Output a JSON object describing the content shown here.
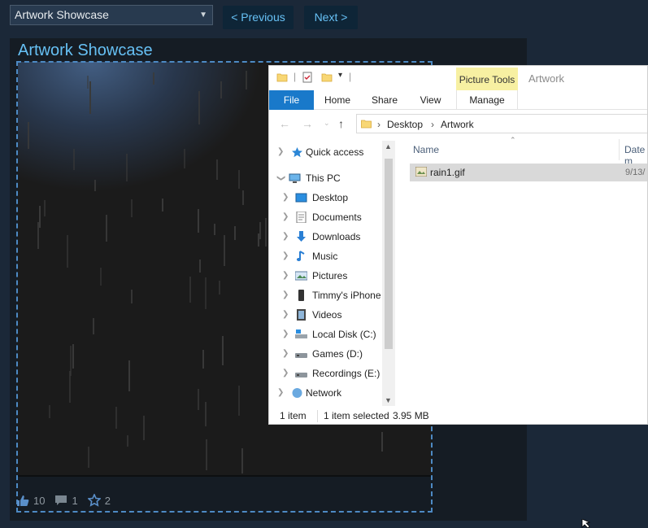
{
  "top": {
    "showcase_select": "Artwork Showcase",
    "prev_label": "< Previous",
    "next_label": "Next >"
  },
  "showcase": {
    "title": "Artwork Showcase",
    "stats": {
      "likes": "10",
      "comments": "1",
      "awards": "2"
    }
  },
  "explorer": {
    "contextual_tab_header": "Picture Tools",
    "window_title": "Artwork",
    "tabs": [
      "File",
      "Home",
      "Share",
      "View",
      "Manage"
    ],
    "breadcrumb": [
      "Desktop",
      "Artwork"
    ],
    "nav_tree": [
      {
        "label": "Quick access",
        "icon": "star-icon"
      },
      {
        "label": "This PC",
        "icon": "computer-icon"
      },
      {
        "label": "Desktop",
        "icon": "desktop-folder-icon"
      },
      {
        "label": "Documents",
        "icon": "documents-icon"
      },
      {
        "label": "Downloads",
        "icon": "downloads-icon"
      },
      {
        "label": "Music",
        "icon": "music-icon"
      },
      {
        "label": "Pictures",
        "icon": "pictures-icon"
      },
      {
        "label": "Timmy's iPhone",
        "icon": "phone-icon"
      },
      {
        "label": "Videos",
        "icon": "videos-icon"
      },
      {
        "label": "Local Disk (C:)",
        "icon": "local-disk-icon"
      },
      {
        "label": "Games (D:)",
        "icon": "drive-icon"
      },
      {
        "label": "Recordings (E:)",
        "icon": "drive-icon"
      },
      {
        "label": "Network",
        "icon": "network-icon"
      }
    ],
    "columns": {
      "name": "Name",
      "date": "Date m"
    },
    "files": [
      {
        "name": "rain1.gif",
        "date": "9/13/"
      }
    ],
    "status": {
      "count": "1 item",
      "selected": "1 item selected",
      "size": "3.95 MB"
    }
  },
  "colors": {
    "steam_bg": "#1b2838",
    "accent_blue": "#66c0f4",
    "file_tab": "#1979ca",
    "picture_tools": "#f7f0a2"
  }
}
